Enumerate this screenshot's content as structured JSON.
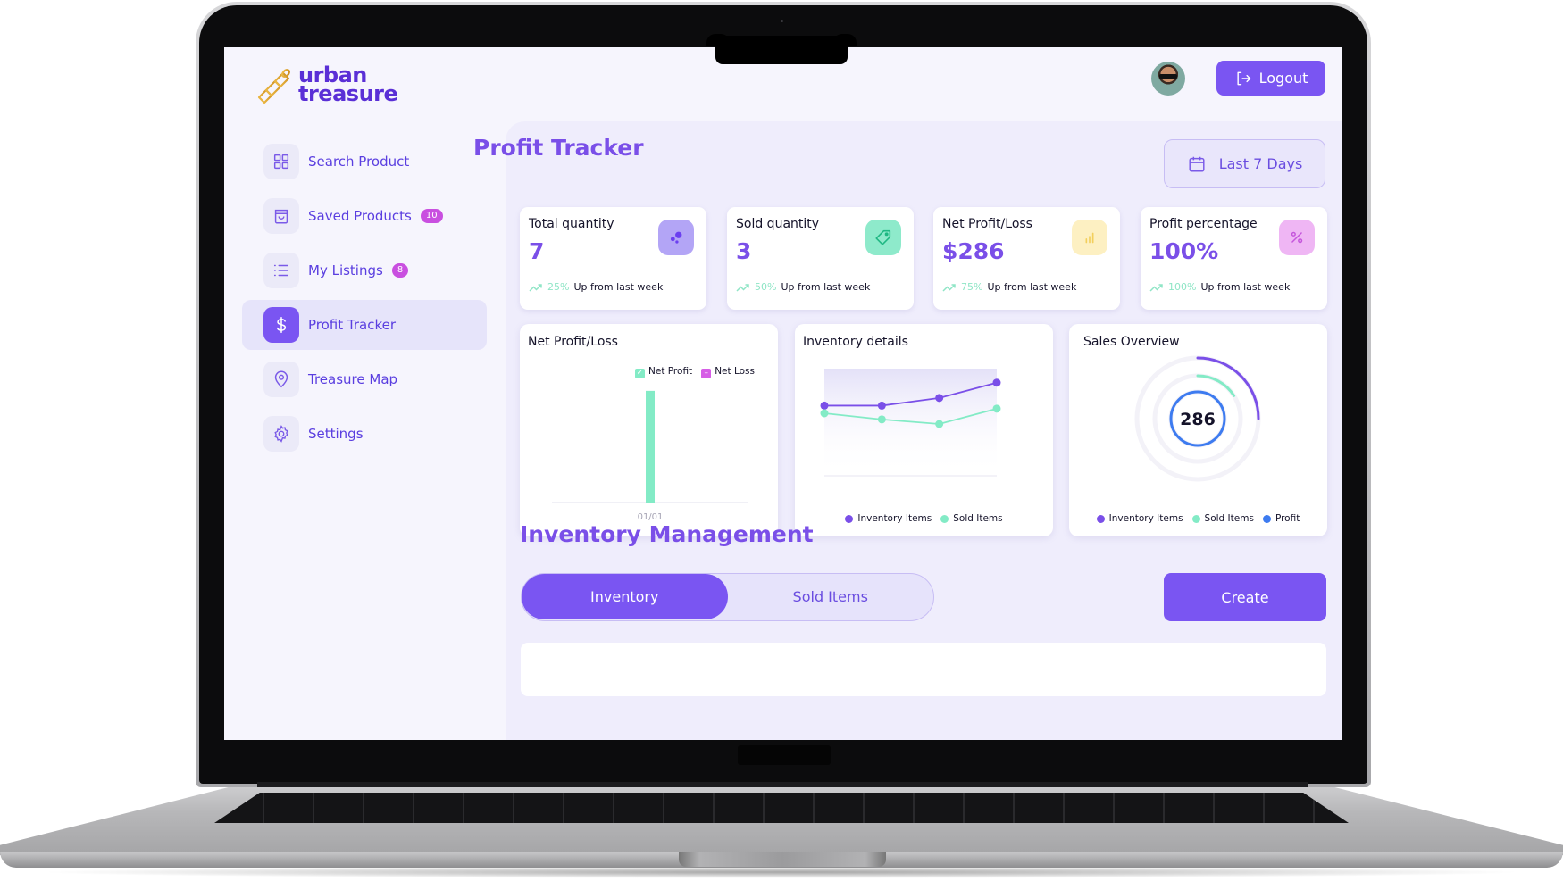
{
  "brand": {
    "name_line1": "urban",
    "name_line2": "treasure"
  },
  "sidebar": {
    "items": [
      {
        "label": "Search Product",
        "icon": "grid-icon",
        "badge": null,
        "active": false
      },
      {
        "label": "Saved Products",
        "icon": "shopping-bag-icon",
        "badge": "10",
        "active": false
      },
      {
        "label": "My Listings",
        "icon": "list-icon",
        "badge": "8",
        "active": false
      },
      {
        "label": "Profit Tracker",
        "icon": "dollar-icon",
        "badge": null,
        "active": true
      },
      {
        "label": "Treasure Map",
        "icon": "map-pin-icon",
        "badge": null,
        "active": false
      },
      {
        "label": "Settings",
        "icon": "gear-icon",
        "badge": null,
        "active": false
      }
    ]
  },
  "header": {
    "logout_label": "Logout"
  },
  "page": {
    "title": "Profit Tracker",
    "date_range": "Last 7 Days"
  },
  "stats": [
    {
      "title": "Total quantity",
      "value": "7",
      "change": "25%",
      "change_text": "Up from last week",
      "icon": "bubbles-icon",
      "icon_bg": "#b3a5f6",
      "icon_color": "#6b3ff0"
    },
    {
      "title": "Sold quantity",
      "value": "3",
      "change": "50%",
      "change_text": "Up from last week",
      "icon": "tag-icon",
      "icon_bg": "#8eeacb",
      "icon_color": "#1fb883"
    },
    {
      "title": "Net Profit/Loss",
      "value": "$286",
      "change": "75%",
      "change_text": "Up from last week",
      "icon": "bar-chart-icon",
      "icon_bg": "#fdf0c2",
      "icon_color": "#f3cf5c"
    },
    {
      "title": "Profit percentage",
      "value": "100%",
      "change": "100%",
      "change_text": "Up from last week",
      "icon": "percent-icon",
      "icon_bg": "#efb6f4",
      "icon_color": "#c555dc"
    }
  ],
  "chart_data": [
    {
      "type": "bar",
      "title": "Net Profit/Loss",
      "categories": [
        "01/01"
      ],
      "series": [
        {
          "name": "Net Profit",
          "values": [
            286
          ],
          "color": "#83ebc6"
        },
        {
          "name": "Net Loss",
          "values": [
            0
          ],
          "color": "#d65ee6"
        }
      ],
      "legend": "top-right",
      "ylim": [
        0,
        320
      ]
    },
    {
      "type": "line",
      "title": "Inventory details",
      "x": [
        1,
        2,
        3,
        4
      ],
      "series": [
        {
          "name": "Inventory Items",
          "values": [
            4,
            4,
            4.5,
            5.5
          ],
          "color": "#7a4fe8"
        },
        {
          "name": "Sold Items",
          "values": [
            3.5,
            3.1,
            2.8,
            3.8
          ],
          "color": "#83ebc6"
        }
      ],
      "ylim": [
        0,
        7
      ],
      "legend": "bottom"
    },
    {
      "type": "pie",
      "title": "Sales Overview",
      "center_label": "286",
      "series": [
        {
          "name": "Inventory Items",
          "fraction": 0.25,
          "color": "#7a4fe8"
        },
        {
          "name": "Sold Items",
          "fraction": 0.16,
          "color": "#83ebc6"
        },
        {
          "name": "Profit",
          "fraction": 1.0,
          "color": "#3d7bf0"
        }
      ],
      "legend": "bottom"
    }
  ],
  "inventory": {
    "title": "Inventory Management",
    "tabs": [
      {
        "label": "Inventory",
        "active": true
      },
      {
        "label": "Sold Items",
        "active": false
      }
    ],
    "create_label": "Create"
  }
}
